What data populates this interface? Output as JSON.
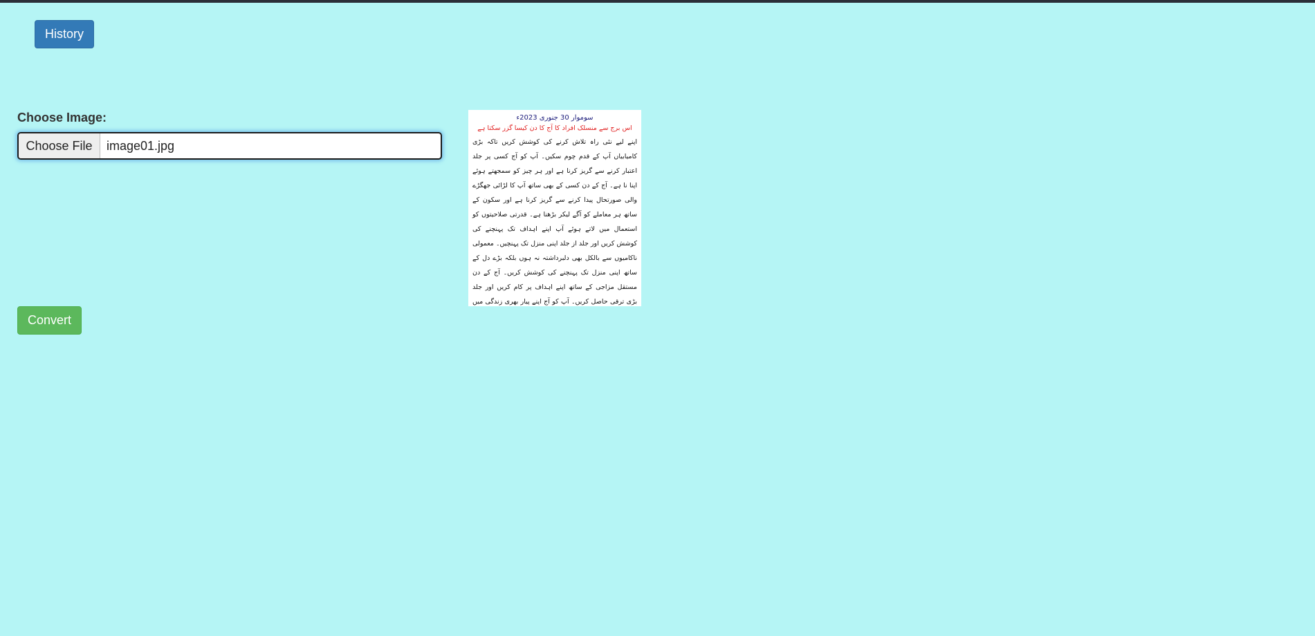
{
  "header": {
    "history_label": "History"
  },
  "form": {
    "choose_label": "Choose Image:",
    "file_button_label": "Choose File",
    "file_name": "image01.jpg",
    "convert_label": "Convert"
  },
  "preview": {
    "date": "سوموار 30 جنوری 2023ء",
    "headline": "اس برج سے منسلک افراد کا آج کا دن کیسا گزر سکتا ہے",
    "body": "اپنے لیے نئی راہ تلاش کرنے کی کوشش کریں تاکہ بڑی کامیابیاں آپ کے قدم چوم سکیں۔ آپ کو آج کسی پر جلد اعتبار کرنے سے گریز کرنا ہے اور ہر چیز کو سمجھتے ہوئے اپنا نا ہے۔ آج کے دن کسی کے بھی ساتھ آپ کا لڑائی جھگڑے والی صورتحال پیدا کرنے سے گریز کرنا ہے اور سکون کے ساتھ ہر معاملے کو آگے لیکر بڑھنا ہے۔ قدرتی صلاحیتوں کو استعمال میں لاتے ہوئے آپ اپنے اہداف تک پہنچنے کی کوشش کریں اور جلد از جلد اپنی منزل تک پہنچیں۔ معمولی ناکامیوں سے بالکل بھی دلبرداشتہ نہ ہوں بلکہ بڑے دل کے ساتھ اپنی منزل تک پہنچنے کی کوشش کریں۔ آج کے دن مستقل مزاجی کے ساتھ اپنے اہداف پر کام کریں اور جلد بڑی ترقی حاصل کریں۔ آپ کو آج اپنے پیار بھری زندگی میں لطف اٹھانے کا پورا موقع مل سکتا ہے۔ اس وقت ایک شاندار ساتھی آپ کی زندگی میں داخل ہوسکتا ہے جو آپ کے لیے خوش قسمت ثابت ہوگا۔ دوپہر کے بعد سے آپ کو مالی طور پر اچھی خبریں سننے کو مل سکتی ہیں۔"
  },
  "colors": {
    "page_background": "#b5f5f5",
    "primary_button": "#337ab7",
    "success_button": "#5cb85c"
  }
}
